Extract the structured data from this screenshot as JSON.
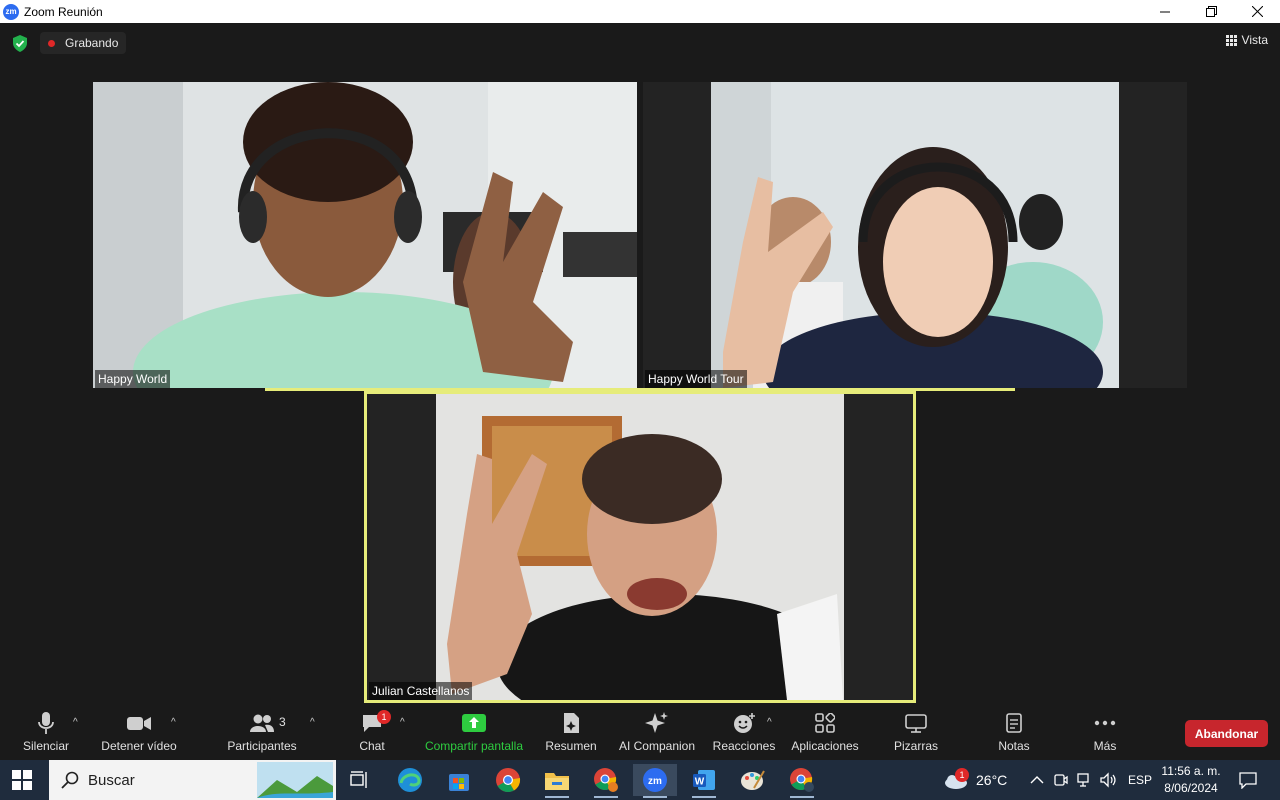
{
  "window": {
    "title": "Zoom Reunión",
    "logo_text": "zm"
  },
  "topbar": {
    "recording_label": "Grabando",
    "view_label": "Vista"
  },
  "participants": [
    {
      "name": "Happy World"
    },
    {
      "name": "Happy World Tour"
    },
    {
      "name": "Julian Castellanos"
    }
  ],
  "toolbar": {
    "mute_label": "Silenciar",
    "video_label": "Detener vídeo",
    "participants_label": "Participantes",
    "participants_count": "3",
    "chat_label": "Chat",
    "chat_badge": "1",
    "share_label": "Compartir pantalla",
    "summary_label": "Resumen",
    "companion_label": "AI Companion",
    "reactions_label": "Reacciones",
    "apps_label": "Aplicaciones",
    "whiteboards_label": "Pizarras",
    "notes_label": "Notas",
    "more_label": "Más",
    "leave_label": "Abandonar"
  },
  "taskbar": {
    "search_label": "Buscar",
    "weather_temp": "26°C",
    "weather_badge": "1",
    "language": "ESP",
    "time": "11:56 a. m.",
    "date": "8/06/2024",
    "zoom_icon_text": "zm",
    "word_icon_text": "W"
  },
  "colors": {
    "active_speaker_border": "#e6ec7a",
    "share_green": "#2ecc40",
    "leave_red": "#c7262d",
    "recording_red": "#e02828",
    "taskbar_bg": "#1f2c3d"
  }
}
